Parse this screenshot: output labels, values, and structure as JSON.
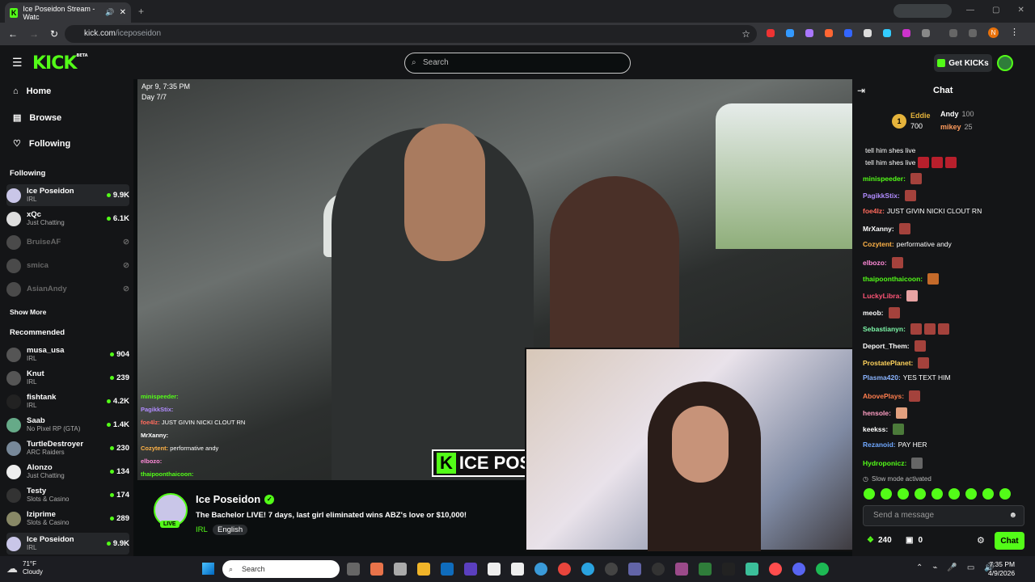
{
  "browser": {
    "tab_title": "Ice Poseidon Stream - Watc",
    "url_host": "kick.com",
    "url_path": "/iceposeidon",
    "profile_initial": "N"
  },
  "topnav": {
    "logo": "KICK",
    "logo_badge": "BETA",
    "search_placeholder": "Search",
    "get_kicks": "Get KICKs"
  },
  "sidebar": {
    "nav": [
      {
        "label": "Home"
      },
      {
        "label": "Browse"
      },
      {
        "label": "Following"
      }
    ],
    "following_title": "Following",
    "following": [
      {
        "name": "Ice Poseidon",
        "category": "IRL",
        "viewers": "9.9K"
      },
      {
        "name": "xQc",
        "category": "Just Chatting",
        "viewers": "6.1K"
      },
      {
        "name": "BruiseAF",
        "category": "",
        "viewers": ""
      },
      {
        "name": "smica",
        "category": "",
        "viewers": ""
      },
      {
        "name": "AsianAndy",
        "category": "",
        "viewers": ""
      }
    ],
    "show_more": "Show More",
    "recommended_title": "Recommended",
    "recommended": [
      {
        "name": "musa_usa",
        "category": "IRL",
        "viewers": "904"
      },
      {
        "name": "Knut",
        "category": "IRL",
        "viewers": "239"
      },
      {
        "name": "fishtank",
        "category": "IRL",
        "viewers": "4.2K"
      },
      {
        "name": "Saab",
        "category": "No Pixel RP (GTA)",
        "viewers": "1.4K"
      },
      {
        "name": "TurtleDestroyer",
        "category": "ARC Raiders",
        "viewers": "230"
      },
      {
        "name": "Alonzo",
        "category": "Just Chatting",
        "viewers": "134"
      },
      {
        "name": "Testy",
        "category": "Slots & Casino",
        "viewers": "174"
      },
      {
        "name": "Iziprime",
        "category": "Slots & Casino",
        "viewers": "289"
      },
      {
        "name": "Ice Poseidon",
        "category": "IRL",
        "viewers": "9.9K"
      }
    ]
  },
  "video": {
    "date_line": "Apr 9, 7:35 PM",
    "day_line": "Day 7/7",
    "watermark": "ICE POS",
    "overlay_chat": [
      {
        "user": "minispeeder:",
        "text": ""
      },
      {
        "user": "PagikkStix:",
        "text": ""
      },
      {
        "user": "foe4lz:",
        "text": "JUST GIVIN NICKI CLOUT RN"
      },
      {
        "user": "MrXanny:",
        "text": ""
      },
      {
        "user": "Cozytent:",
        "text": "performative andy"
      },
      {
        "user": "elbozo:",
        "text": ""
      },
      {
        "user": "thaipoonthaicoon:",
        "text": ""
      }
    ]
  },
  "stream": {
    "name": "Ice Poseidon",
    "title": "The Bachelor LIVE! 7 days, last girl eliminated wins ABZ's love or $10,000!",
    "live": "LIVE",
    "tags": [
      "IRL",
      "English"
    ]
  },
  "chat": {
    "title": "Chat",
    "leaders": [
      {
        "rank": "1",
        "name": "Eddie",
        "value": "700"
      },
      {
        "name": "Andy",
        "value": "100"
      },
      {
        "name": "mikey",
        "value": "25"
      }
    ],
    "messages": [
      {
        "user": "",
        "text": "tell him shes live"
      },
      {
        "user": "",
        "text": "tell him shes live"
      },
      {
        "user": "minispeeder:",
        "text": "",
        "color": "#53fc18"
      },
      {
        "user": "PagikkStix:",
        "text": "",
        "color": "#b18cff"
      },
      {
        "user": "foe4lz:",
        "text": "JUST GIVIN NICKI CLOUT RN",
        "color": "#ff6a5c"
      },
      {
        "user": "MrXanny:",
        "text": "",
        "color": "#ffffff"
      },
      {
        "user": "Cozytent:",
        "text": "performative andy",
        "color": "#ffb347"
      },
      {
        "user": "elbozo:",
        "text": "",
        "color": "#ff8ad8"
      },
      {
        "user": "thaipoonthaicoon:",
        "text": "",
        "color": "#53fc18"
      },
      {
        "user": "LuckyLibra:",
        "text": "",
        "color": "#ff5577"
      },
      {
        "user": "meob:",
        "text": "",
        "color": "#ffffff"
      },
      {
        "user": "Sebastianyn:",
        "text": "",
        "color": "#7cf7a8"
      },
      {
        "user": "Deport_Them:",
        "text": "",
        "color": "#ffffff"
      },
      {
        "user": "ProstatePlanet:",
        "text": "",
        "color": "#ffd35c"
      },
      {
        "user": "Plasma420:",
        "text": "YES TEXT HIM",
        "color": "#8ab4ff"
      },
      {
        "user": "AbovePlays:",
        "text": "",
        "color": "#ff7d4d"
      },
      {
        "user": "hensole:",
        "text": "",
        "color": "#ff9ec4"
      },
      {
        "user": "keekss:",
        "text": "",
        "color": "#ffffff"
      },
      {
        "user": "Rezanoid:",
        "text": "PAY HER",
        "color": "#6fa8ff"
      },
      {
        "user": "Hydroponicz:",
        "text": "",
        "color": "#53fc18"
      }
    ],
    "slow_mode": "Slow mode activated",
    "input_placeholder": "Send a message",
    "points": "240",
    "count2": "0",
    "send": "Chat"
  },
  "taskbar": {
    "weather_temp": "71°F",
    "weather_desc": "Cloudy",
    "search": "Search",
    "time": "7:35 PM",
    "date": "4/9/2026"
  }
}
